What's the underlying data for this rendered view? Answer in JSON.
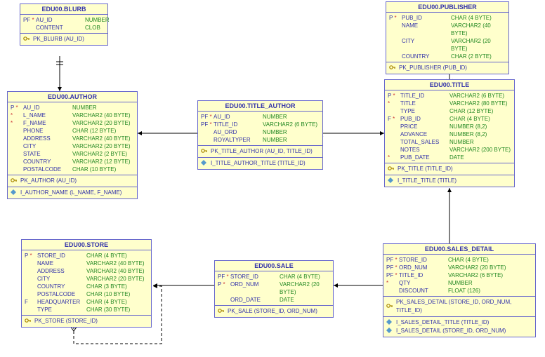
{
  "entities": {
    "blurb": {
      "title": "EDU00.BLURB",
      "cols": [
        {
          "flags": "PF *",
          "name": "AU_ID",
          "type": "NUMBER"
        },
        {
          "flags": "",
          "name": "CONTENT",
          "type": "CLOB"
        }
      ],
      "keys": [
        {
          "icon": "🔑",
          "text": "PK_BLURB (AU_ID)"
        }
      ]
    },
    "author": {
      "title": "EDU00.AUTHOR",
      "cols": [
        {
          "flags": "P *",
          "name": "AU_ID",
          "type": "NUMBER"
        },
        {
          "flags": "*",
          "name": "L_NAME",
          "type": "VARCHAR2 (40 BYTE)"
        },
        {
          "flags": "*",
          "name": "F_NAME",
          "type": "VARCHAR2 (20 BYTE)"
        },
        {
          "flags": "",
          "name": "PHONE",
          "type": "CHAR (12 BYTE)"
        },
        {
          "flags": "",
          "name": "ADDRESS",
          "type": "VARCHAR2 (40 BYTE)"
        },
        {
          "flags": "",
          "name": "CITY",
          "type": "VARCHAR2 (20 BYTE)"
        },
        {
          "flags": "",
          "name": "STATE",
          "type": "VARCHAR2 (2 BYTE)"
        },
        {
          "flags": "",
          "name": "COUNTRY",
          "type": "VARCHAR2 (12 BYTE)"
        },
        {
          "flags": "",
          "name": "POSTALCODE",
          "type": "CHAR (10 BYTE)"
        }
      ],
      "keys": [
        {
          "icon": "🔑",
          "text": "PK_AUTHOR (AU_ID)"
        },
        {
          "icon": "◆",
          "text": "I_AUTHOR_NAME (L_NAME, F_NAME)"
        }
      ]
    },
    "title_author": {
      "title": "EDU00.TITLE_AUTHOR",
      "cols": [
        {
          "flags": "PF *",
          "name": "AU_ID",
          "type": "NUMBER"
        },
        {
          "flags": "PF *",
          "name": "TITLE_ID",
          "type": "VARCHAR2 (6 BYTE)"
        },
        {
          "flags": "",
          "name": "AU_ORD",
          "type": "NUMBER"
        },
        {
          "flags": "",
          "name": "ROYALTYPER",
          "type": "NUMBER"
        }
      ],
      "keys": [
        {
          "icon": "🔑",
          "text": "PK_TITLE_AUTHOR (AU_ID, TITLE_ID)"
        },
        {
          "icon": "◆",
          "text": "I_TITLE_AUTHOR_TITLE (TITLE_ID)"
        }
      ]
    },
    "publisher": {
      "title": "EDU00.PUBLISHER",
      "cols": [
        {
          "flags": "P *",
          "name": "PUB_ID",
          "type": "CHAR (4 BYTE)"
        },
        {
          "flags": "",
          "name": "NAME",
          "type": "VARCHAR2 (40 BYTE)"
        },
        {
          "flags": "",
          "name": "CITY",
          "type": "VARCHAR2 (20 BYTE)"
        },
        {
          "flags": "",
          "name": "COUNTRY",
          "type": "CHAR (2 BYTE)"
        }
      ],
      "keys": [
        {
          "icon": "🔑",
          "text": "PK_PUBLISHER (PUB_ID)"
        }
      ]
    },
    "title": {
      "title": "EDU00.TITLE",
      "cols": [
        {
          "flags": "P *",
          "name": "TITLE_ID",
          "type": "VARCHAR2 (6 BYTE)"
        },
        {
          "flags": "*",
          "name": "TITLE",
          "type": "VARCHAR2 (80 BYTE)"
        },
        {
          "flags": "",
          "name": "TYPE",
          "type": "CHAR (12 BYTE)"
        },
        {
          "flags": "F *",
          "name": "PUB_ID",
          "type": "CHAR (4 BYTE)"
        },
        {
          "flags": "",
          "name": "PRICE",
          "type": "NUMBER (8,2)"
        },
        {
          "flags": "",
          "name": "ADVANCE",
          "type": "NUMBER (8,2)"
        },
        {
          "flags": "",
          "name": "TOTAL_SALES",
          "type": "NUMBER"
        },
        {
          "flags": "",
          "name": "NOTES",
          "type": "VARCHAR2 (200 BYTE)"
        },
        {
          "flags": "*",
          "name": "PUB_DATE",
          "type": "DATE"
        }
      ],
      "keys": [
        {
          "icon": "🔑",
          "text": "PK_TITLE (TITLE_ID)"
        },
        {
          "icon": "◆",
          "text": "I_TITLE_TITLE (TITLE)"
        }
      ]
    },
    "store": {
      "title": "EDU00.STORE",
      "cols": [
        {
          "flags": "P *",
          "name": "STORE_ID",
          "type": "CHAR (4 BYTE)"
        },
        {
          "flags": "",
          "name": "NAME",
          "type": "VARCHAR2 (40 BYTE)"
        },
        {
          "flags": "",
          "name": "ADDRESS",
          "type": "VARCHAR2 (40 BYTE)"
        },
        {
          "flags": "",
          "name": "CITY",
          "type": "VARCHAR2 (20 BYTE)"
        },
        {
          "flags": "",
          "name": "COUNTRY",
          "type": "CHAR (3 BYTE)"
        },
        {
          "flags": "",
          "name": "POSTALCODE",
          "type": "CHAR (10 BYTE)"
        },
        {
          "flags": "F",
          "name": "HEADQUARTER",
          "type": "CHAR (4 BYTE)"
        },
        {
          "flags": "",
          "name": "TYPE",
          "type": "CHAR (30 BYTE)"
        }
      ],
      "keys": [
        {
          "icon": "🔑",
          "text": "PK_STORE (STORE_ID)"
        }
      ]
    },
    "sale": {
      "title": "EDU00.SALE",
      "cols": [
        {
          "flags": "PF *",
          "name": "STORE_ID",
          "type": "CHAR (4 BYTE)"
        },
        {
          "flags": "P *",
          "name": "ORD_NUM",
          "type": "VARCHAR2 (20 BYTE)"
        },
        {
          "flags": "",
          "name": "ORD_DATE",
          "type": "DATE"
        }
      ],
      "keys": [
        {
          "icon": "🔑",
          "text": "PK_SALE (STORE_ID, ORD_NUM)"
        }
      ]
    },
    "sales_detail": {
      "title": "EDU00.SALES_DETAIL",
      "cols": [
        {
          "flags": "PF *",
          "name": "STORE_ID",
          "type": "CHAR (4 BYTE)"
        },
        {
          "flags": "PF *",
          "name": "ORD_NUM",
          "type": "VARCHAR2 (20 BYTE)"
        },
        {
          "flags": "PF *",
          "name": "TITLE_ID",
          "type": "VARCHAR2 (6 BYTE)"
        },
        {
          "flags": "*",
          "name": "QTY",
          "type": "NUMBER"
        },
        {
          "flags": "",
          "name": "DISCOUNT",
          "type": "FLOAT (126)"
        }
      ],
      "keys": [
        {
          "icon": "🔑",
          "text": "PK_SALES_DETAIL (STORE_ID, ORD_NUM, TITLE_ID)"
        },
        {
          "icon": "◆",
          "text": "I_SALES_DETAIL_TITLE (TITLE_ID)"
        },
        {
          "icon": "◆",
          "text": "I_SALES_DETAIL (STORE_ID, ORD_NUM)"
        }
      ]
    }
  }
}
